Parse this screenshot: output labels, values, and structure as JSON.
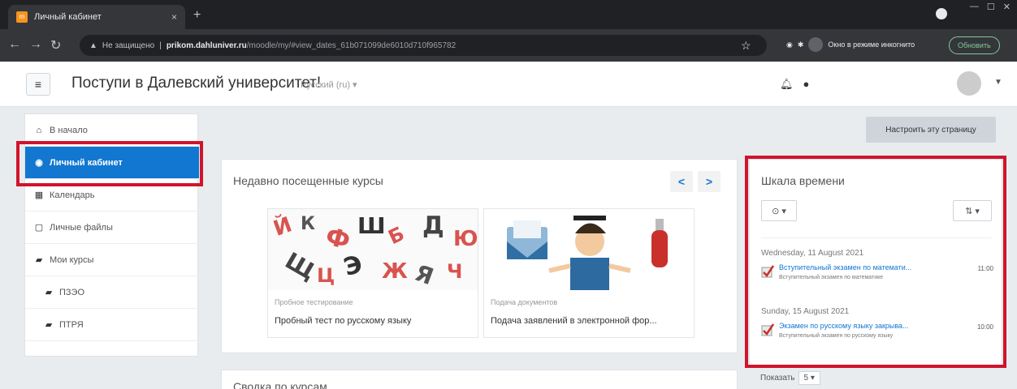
{
  "browser": {
    "tab_title": "Личный кабинет",
    "tab_close": "×",
    "new_tab": "+",
    "url_warning": "Не защищено",
    "url_host": "prikom.dahluniver.ru",
    "url_path": "/moodle/my/#view_dates_61b071099de6010d710f965782",
    "incognito_label": "Окно в режиме инкогнито",
    "update_label": "Обновить"
  },
  "header": {
    "site_name": "Поступи в Далевский университет!",
    "language": "Русский (ru) ▾"
  },
  "sidebar": {
    "items": [
      {
        "label": "В начало",
        "icon": "⌂"
      },
      {
        "label": "Личный кабинет",
        "icon": "◉"
      },
      {
        "label": "Календарь",
        "icon": "▦"
      },
      {
        "label": "Личные файлы",
        "icon": "▢"
      },
      {
        "label": "Мои курсы",
        "icon": "▰"
      },
      {
        "label": "ПЗЭО",
        "icon": "▰"
      },
      {
        "label": "ПТРЯ",
        "icon": "▰"
      }
    ]
  },
  "main": {
    "customize_label": "Настроить эту страницу",
    "recent_title": "Недавно посещенные курсы",
    "pager_prev": "<",
    "pager_next": ">",
    "courses": [
      {
        "category": "Пробное тестирование",
        "name": "Пробный тест по русскому языку"
      },
      {
        "category": "Подача документов",
        "name": "Подача заявлений в электронной фор..."
      }
    ],
    "summary_title": "Сводка по курсам"
  },
  "timeline": {
    "title": "Шкала времени",
    "filter_label": "⊙ ▾",
    "sort_label": "⇅ ▾",
    "groups": [
      {
        "date": "Wednesday, 11 August 2021",
        "event": "Вступительный экзамен по математи...",
        "course": "Вступительный экзамен по математике",
        "time": "11:00"
      },
      {
        "date": "Sunday, 15 August 2021",
        "event": "Экзамен по русскому языку закрыва...",
        "course": "Вступительный экзамен по русскому языку",
        "time": "10:00"
      }
    ],
    "show_label": "Показать",
    "show_value": "5 ▾"
  },
  "colors": {
    "accent": "#1177d1",
    "highlight": "#d0142c"
  }
}
